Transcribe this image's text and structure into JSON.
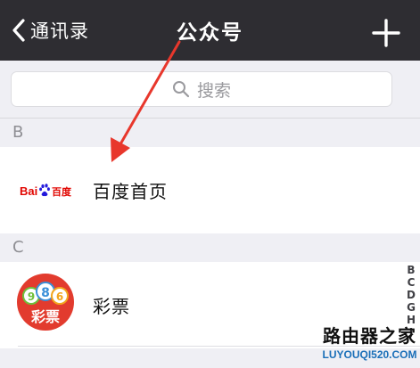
{
  "navbar": {
    "back_label": "通讯录",
    "title": "公众号",
    "back_icon": "chevron-left-icon",
    "add_icon": "plus-icon"
  },
  "search": {
    "placeholder": "搜索",
    "icon": "search-icon"
  },
  "sections": [
    {
      "letter": "B",
      "accounts": [
        {
          "name": "百度首页",
          "logo_text": "Bai百度"
        }
      ]
    },
    {
      "letter": "C",
      "accounts": [
        {
          "name": "彩票",
          "logo_digits": [
            "9",
            "8",
            "6"
          ],
          "logo_text": "彩票"
        }
      ]
    }
  ],
  "index_letters": [
    "B",
    "C",
    "D",
    "G",
    "H",
    "J"
  ],
  "watermark": {
    "cn": "路由器之家",
    "en": "LUYOUQI520.COM"
  },
  "colors": {
    "navbar_bg": "#2e2d32",
    "arrow": "#e8372c",
    "baidu_red": "#e10601",
    "baidu_blue": "#2319dc",
    "caipiao_red": "#e23b2e"
  }
}
